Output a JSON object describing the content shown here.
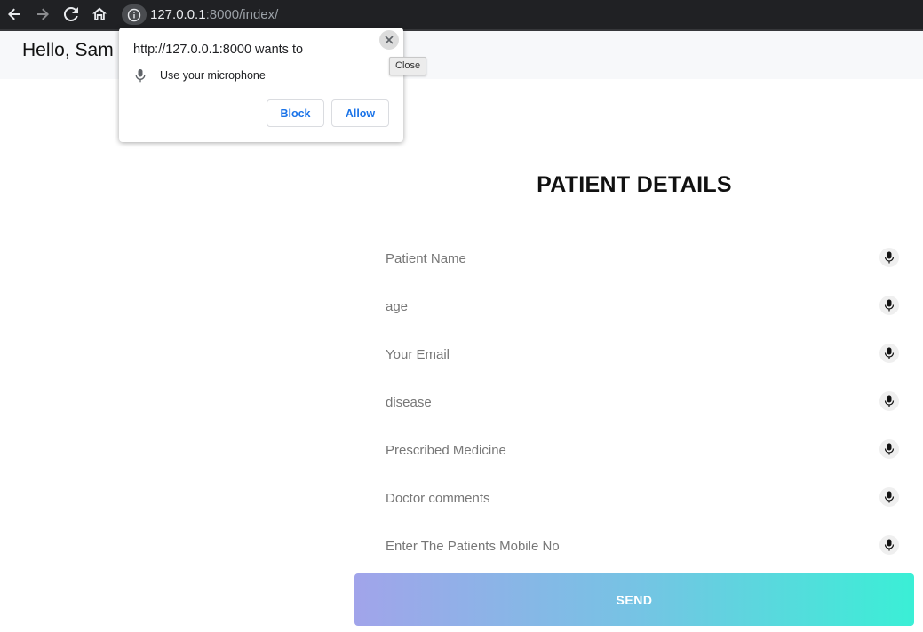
{
  "browser": {
    "url_host": "127.0.0.1",
    "url_rest": ":8000/index/",
    "icons": [
      "back-arrow-icon",
      "forward-arrow-icon",
      "reload-icon",
      "home-icon",
      "info-icon"
    ]
  },
  "header": {
    "greeting": "Hello, Sam"
  },
  "form": {
    "title": "PATIENT DETAILS",
    "fields": [
      {
        "placeholder": "Patient Name",
        "icon": "microphone-icon"
      },
      {
        "placeholder": "age",
        "icon": "microphone-icon"
      },
      {
        "placeholder": "Your Email",
        "icon": "microphone-icon"
      },
      {
        "placeholder": "disease",
        "icon": "microphone-icon"
      },
      {
        "placeholder": "Prescribed Medicine",
        "icon": "microphone-icon"
      },
      {
        "placeholder": "Doctor comments",
        "icon": "microphone-icon"
      },
      {
        "placeholder": "Enter The Patients Mobile No",
        "icon": "microphone-icon"
      }
    ],
    "send_label": "SEND",
    "send_gradient": [
      "#a1a4ea",
      "#76c3e4",
      "#3aefd6"
    ]
  },
  "permission_popup": {
    "title": "http://127.0.0.1:8000 wants to",
    "permission": "Use your microphone",
    "block_label": "Block",
    "allow_label": "Allow",
    "close_tooltip": "Close",
    "button_color": "#1a73e8"
  }
}
